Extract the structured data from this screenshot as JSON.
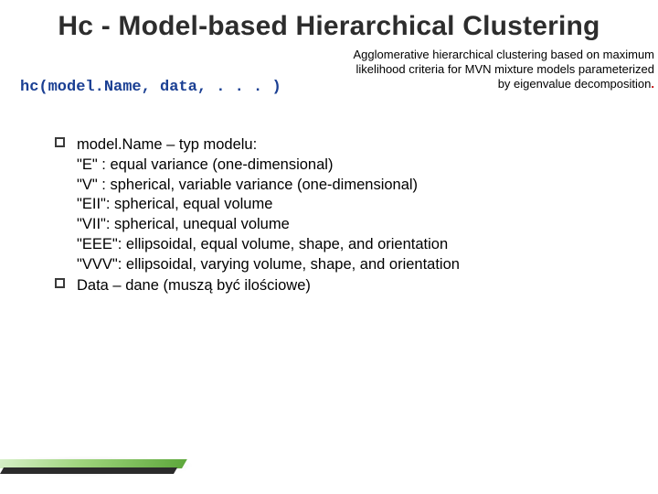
{
  "title": "Hc - Model-based Hierarchical Clustering",
  "code_call": "hc(model.Name, data, . . . )",
  "description": "Agglomerative hierarchical clustering based on maximum likelihood criteria for MVN mixture models parameterized by eigenvalue decomposition",
  "bullets": [
    {
      "lines": [
        "model.Name – typ modelu:",
        "\"E\" : equal variance (one-dimensional)",
        "\"V\" : spherical, variable variance (one-dimensional)",
        "\"EII\": spherical, equal volume",
        "\"VII\": spherical, unequal volume",
        "\"EEE\": ellipsoidal, equal volume, shape, and orientation",
        "\"VVV\": ellipsoidal, varying volume, shape, and orientation"
      ]
    },
    {
      "lines": [
        "Data – dane (muszą być ilościowe)"
      ]
    }
  ]
}
